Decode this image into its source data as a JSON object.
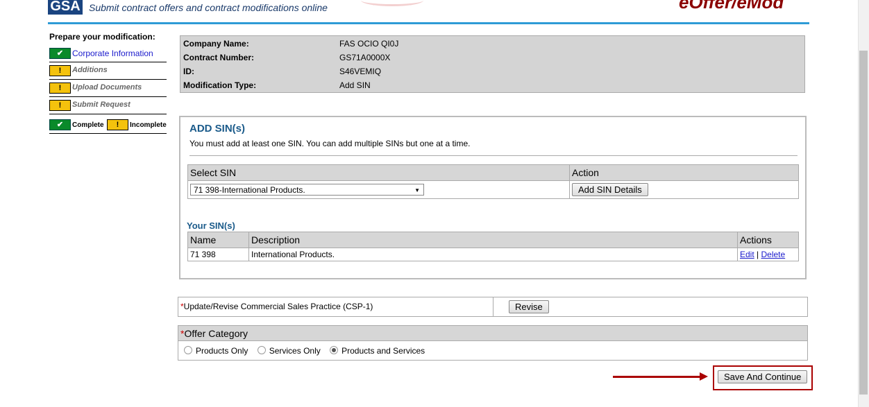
{
  "header": {
    "logo_text": "GSA",
    "tagline": "Submit contract offers and contract modifications online",
    "brand": "eOffer/eMod"
  },
  "sidebar": {
    "title": "Prepare your modification:",
    "items": [
      {
        "label": "Corporate Information",
        "status": "complete"
      },
      {
        "label": "Additions",
        "status": "incomplete"
      },
      {
        "label": "Upload Documents",
        "status": "incomplete"
      },
      {
        "label": "Submit Request",
        "status": "incomplete"
      }
    ],
    "legend": {
      "complete": "Complete",
      "incomplete": "Incomplete"
    }
  },
  "info": {
    "company_label": "Company Name:",
    "company_value": "FAS OCIO QI0J",
    "contract_label": "Contract Number:",
    "contract_value": "GS71A0000X",
    "id_label": "ID:",
    "id_value": "S46VEMIQ",
    "modtype_label": "Modification Type:",
    "modtype_value": "Add SIN"
  },
  "add_sin": {
    "title": "ADD SIN(s)",
    "description": "You must add at least one SIN. You can add multiple SINs but one at a time.",
    "col_select": "Select SIN",
    "col_action": "Action",
    "selected_sin": "71 398-International Products.",
    "add_button": "Add SIN Details"
  },
  "your_sins": {
    "title": "Your SIN(s)",
    "col_name": "Name",
    "col_desc": "Description",
    "col_actions": "Actions",
    "rows": [
      {
        "name": "71 398",
        "description": "International Products.",
        "edit": "Edit",
        "sep": "|",
        "delete": "Delete"
      }
    ]
  },
  "csp": {
    "required_mark": "*",
    "label": "Update/Revise Commercial Sales Practice (CSP-1)",
    "button": "Revise"
  },
  "offer_category": {
    "required_mark": "*",
    "label": "Offer Category",
    "options": [
      "Products Only",
      "Services Only",
      "Products and Services"
    ],
    "selected": "Products and Services"
  },
  "save_button": "Save And Continue"
}
